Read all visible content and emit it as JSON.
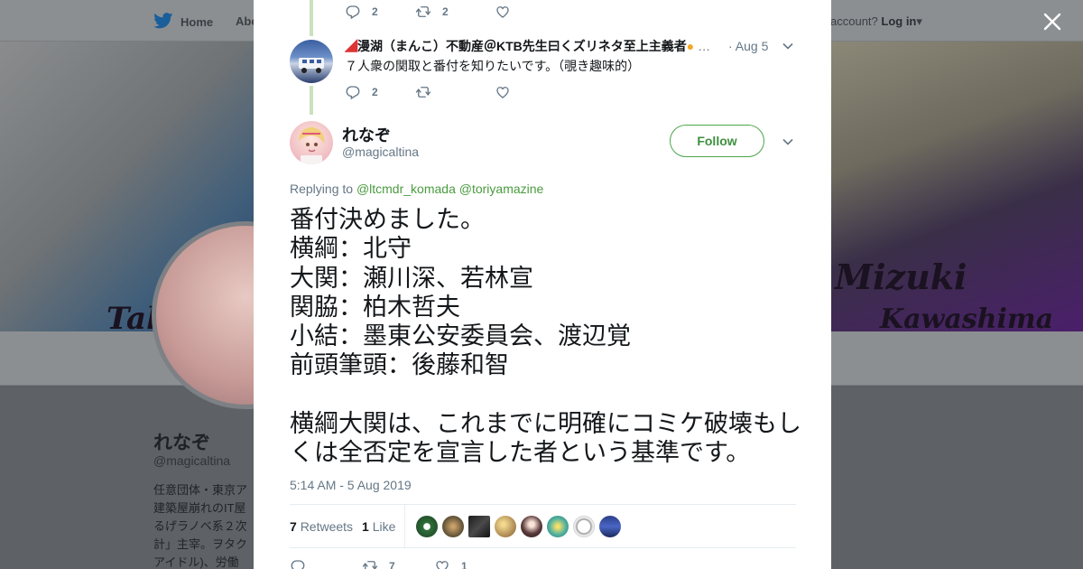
{
  "nav": {
    "home": "Home",
    "about": "Abo",
    "account_prompt": "account?",
    "login": "Log in"
  },
  "banner": {
    "text_right_1": "Mizuki",
    "text_right_2": "Kawashima",
    "text_left": "Tak"
  },
  "profile": {
    "name": "れなぞ",
    "handle": "@magicaltina",
    "bio_lines": [
      "任意団体・東京ア",
      "建築屋崩れのIT屋",
      "るげラノベ系２次",
      "計」主宰。ヲタク",
      "アイドル)、労働"
    ]
  },
  "thread_top": {
    "replies": "2",
    "retweets": "2"
  },
  "reply_tweet": {
    "name": "漫湖（まんこ）不動産＠KTB先生曰くズリネタ至上主義者",
    "ellipsis": "…",
    "date": "· Aug 5",
    "text": "７人衆の関取と番付を知りたいです。（覗き趣味的）",
    "replies": "2"
  },
  "main_tweet": {
    "author_name": "れなぞ",
    "author_handle": "@magicaltina",
    "follow_label": "Follow",
    "replying_prefix": "Replying to",
    "replying_user1": "@ltcmdr_komada",
    "replying_user2": "@toriyamazine",
    "text": "番付決めました。\n横綱：北守\n大関：瀬川深、若林宣\n関脇：柏木哲夫\n小結：墨東公安委員会、渡辺覚\n前頭筆頭：後藤和智\n\n横綱大関は、これまでに明確にコミケ破壊もしくは全否定を宣言した者という基準です。",
    "timestamp": "5:14 AM - 5 Aug 2019",
    "retweet_count": "7",
    "retweet_label": "Retweets",
    "like_count": "1",
    "like_label": "Like",
    "bottom_retweets": "7",
    "bottom_likes": "1"
  },
  "colors": {
    "accent_green": "#4ca64c",
    "thread_line": "#c9e2bd",
    "text_secondary": "#657786"
  },
  "icons": [
    "twitter-bird-icon",
    "close-icon",
    "reply-icon",
    "retweet-icon",
    "like-icon",
    "chevron-down-icon"
  ]
}
